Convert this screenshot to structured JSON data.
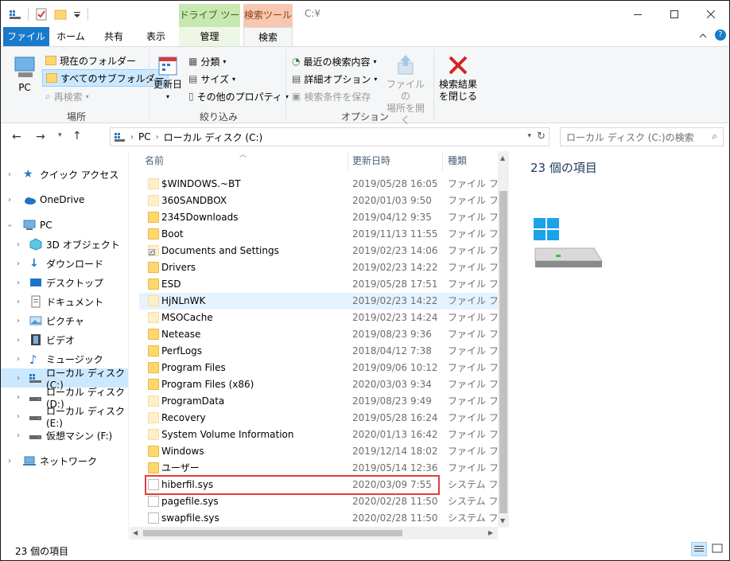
{
  "titlebar": {
    "context_tab_drive": "ドライブ ツール",
    "context_tab_search": "検索ツール",
    "path": "C:¥",
    "colors": {
      "drive_tab": "#c9e7b0",
      "search_tab": "#f7c8b0",
      "file_tab": "#1979ca"
    }
  },
  "tabs": {
    "file": "ファイル",
    "home": "ホーム",
    "share": "共有",
    "view": "表示",
    "manage": "管理",
    "search": "検索"
  },
  "ribbon": {
    "location": {
      "pc": "PC",
      "current_folder": "現在のフォルダー",
      "all_subfolders": "すべてのサブフォルダー",
      "refine_search": "再検索",
      "label": "場所"
    },
    "refine": {
      "date_modified": "更新日",
      "kind": "分類",
      "size": "サイズ",
      "other_properties": "その他のプロパティ",
      "label": "絞り込み"
    },
    "options": {
      "recent_searches": "最近の検索内容",
      "advanced_options": "詳細オプション",
      "save_search": "検索条件を保存",
      "open_file_location_1": "ファイルの",
      "open_file_location_2": "場所を開く",
      "label": "オプション"
    },
    "close": {
      "line1": "検索結果",
      "line2": "を閉じる"
    }
  },
  "address": {
    "crumbs": [
      "PC",
      "ローカル ディスク (C:)"
    ],
    "search_placeholder": "ローカル ディスク (C:)の検索"
  },
  "nav": {
    "items": [
      {
        "label": "クイック アクセス",
        "icon": "star-icon"
      },
      {
        "label": "OneDrive",
        "icon": "cloud-icon"
      },
      {
        "label": "PC",
        "icon": "monitor-icon"
      },
      {
        "label": "3D オブジェクト",
        "icon": "cube-icon"
      },
      {
        "label": "ダウンロード",
        "icon": "download-icon"
      },
      {
        "label": "デスクトップ",
        "icon": "desktop-icon"
      },
      {
        "label": "ドキュメント",
        "icon": "document-icon"
      },
      {
        "label": "ピクチャ",
        "icon": "picture-icon"
      },
      {
        "label": "ビデオ",
        "icon": "video-icon"
      },
      {
        "label": "ミュージック",
        "icon": "music-icon"
      },
      {
        "label": "ローカル ディスク (C:)",
        "icon": "drive-icon"
      },
      {
        "label": "ローカル ディスク (D:)",
        "icon": "drive-icon"
      },
      {
        "label": "ローカル ディスク (E:)",
        "icon": "drive-icon"
      },
      {
        "label": "仮想マシン (F:)",
        "icon": "drive-icon"
      },
      {
        "label": "ネットワーク",
        "icon": "network-icon"
      }
    ]
  },
  "list": {
    "columns": {
      "name": "名前",
      "date": "更新日時",
      "type": "種類"
    },
    "partial_first_row": "",
    "rows": [
      {
        "name": "$WINDOWS.~BT",
        "date": "2019/05/28 16:05",
        "type": "ファイル フォルダー",
        "kind": "folder-faded"
      },
      {
        "name": "360SANDBOX",
        "date": "2020/01/03 9:50",
        "type": "ファイル フォルダー",
        "kind": "folder-faded"
      },
      {
        "name": "2345Downloads",
        "date": "2019/04/12 9:35",
        "type": "ファイル フォルダー",
        "kind": "folder"
      },
      {
        "name": "Boot",
        "date": "2019/11/13 11:55",
        "type": "ファイル フォルダー",
        "kind": "folder"
      },
      {
        "name": "Documents and Settings",
        "date": "2019/02/23 14:06",
        "type": "ファイル フォルダー",
        "kind": "shortcut"
      },
      {
        "name": "Drivers",
        "date": "2019/02/23 14:22",
        "type": "ファイル フォルダー",
        "kind": "folder"
      },
      {
        "name": "ESD",
        "date": "2019/05/28 17:51",
        "type": "ファイル フォルダー",
        "kind": "folder"
      },
      {
        "name": "HjNLnWK",
        "date": "2019/02/23 14:22",
        "type": "ファイル フォルダー",
        "kind": "folder-faded"
      },
      {
        "name": "MSOCache",
        "date": "2019/02/23 14:24",
        "type": "ファイル フォルダー",
        "kind": "folder-faded"
      },
      {
        "name": "Netease",
        "date": "2019/08/23 9:36",
        "type": "ファイル フォルダー",
        "kind": "folder"
      },
      {
        "name": "PerfLogs",
        "date": "2018/04/12 7:38",
        "type": "ファイル フォルダー",
        "kind": "folder"
      },
      {
        "name": "Program Files",
        "date": "2019/09/06 10:12",
        "type": "ファイル フォルダー",
        "kind": "folder"
      },
      {
        "name": "Program Files (x86)",
        "date": "2020/03/03 9:34",
        "type": "ファイル フォルダー",
        "kind": "folder"
      },
      {
        "name": "ProgramData",
        "date": "2019/08/23 9:49",
        "type": "ファイル フォルダー",
        "kind": "folder-faded"
      },
      {
        "name": "Recovery",
        "date": "2019/05/28 16:24",
        "type": "ファイル フォルダー",
        "kind": "folder-faded"
      },
      {
        "name": "System Volume Information",
        "date": "2020/01/13 16:42",
        "type": "ファイル フォルダー",
        "kind": "folder-faded"
      },
      {
        "name": "Windows",
        "date": "2019/12/14 18:02",
        "type": "ファイル フォルダー",
        "kind": "folder"
      },
      {
        "name": "ユーザー",
        "date": "2019/05/14 12:36",
        "type": "ファイル フォルダー",
        "kind": "folder"
      },
      {
        "name": "hiberfil.sys",
        "date": "2020/03/09 7:55",
        "type": "システム ファイル",
        "kind": "sys"
      },
      {
        "name": "pagefile.sys",
        "date": "2020/02/28 11:50",
        "type": "システム ファイル",
        "kind": "sys"
      },
      {
        "name": "swapfile.sys",
        "date": "2020/02/28 11:50",
        "type": "システム ファイル",
        "kind": "sys"
      }
    ]
  },
  "detail": {
    "count": "23 個の項目"
  },
  "status": {
    "count": "23 個の項目"
  }
}
